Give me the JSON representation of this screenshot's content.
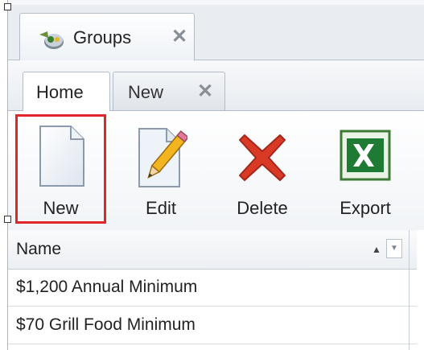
{
  "document_tab": {
    "label": "Groups",
    "icon": "groups-icon",
    "close_icon": "close-icon"
  },
  "ribbon_tabs": [
    {
      "label": "Home",
      "active": true
    },
    {
      "label": "New",
      "active": false,
      "close_icon": "close-icon"
    }
  ],
  "toolbar": {
    "buttons": [
      {
        "label": "New",
        "icon": "new-document-icon",
        "highlighted": true
      },
      {
        "label": "Edit",
        "icon": "edit-document-icon"
      },
      {
        "label": "Delete",
        "icon": "delete-icon"
      },
      {
        "label": "Export",
        "icon": "excel-export-icon"
      }
    ]
  },
  "grid": {
    "columns": [
      {
        "label": "Name",
        "sort": "ascending"
      }
    ],
    "rows": [
      {
        "name": "$1,200 Annual Minimum"
      },
      {
        "name": "$70 Grill Food Minimum"
      }
    ]
  },
  "colors": {
    "highlight": "#e0262b",
    "delete": "#d93a26",
    "excel": "#1f7a34"
  }
}
